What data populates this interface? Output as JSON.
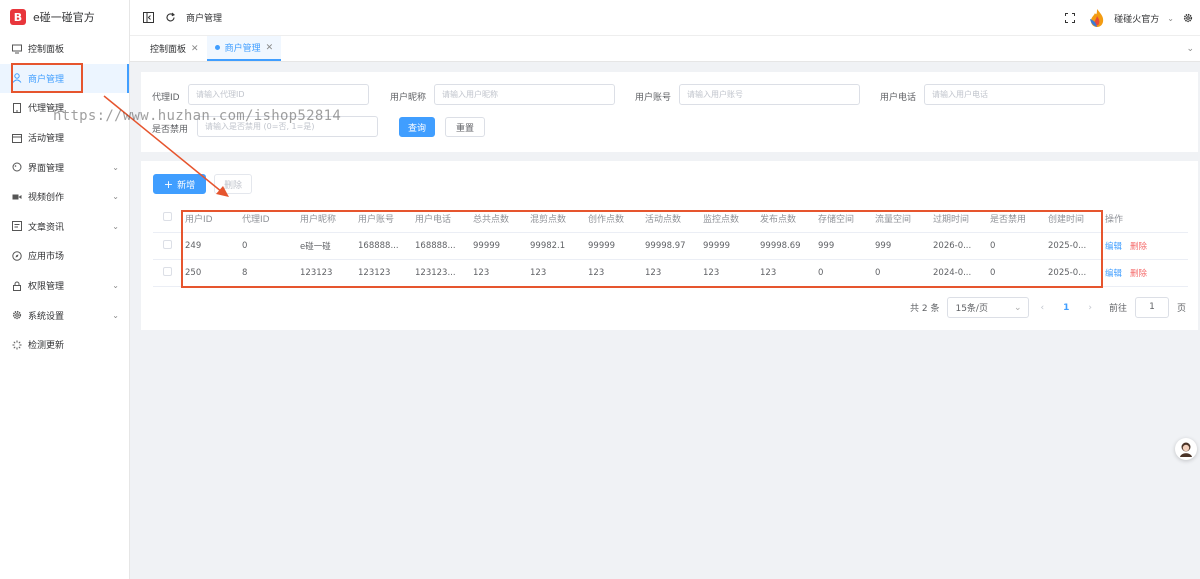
{
  "app": {
    "logo_mark": "B",
    "title": "e碰一碰官方"
  },
  "sidebar": {
    "items": [
      {
        "label": "控制面板",
        "icon": "monitor-icon",
        "expand": false
      },
      {
        "label": "商户管理",
        "icon": "user-icon",
        "expand": false,
        "active": true
      },
      {
        "label": "代理管理",
        "icon": "phone-icon",
        "expand": false
      },
      {
        "label": "活动管理",
        "icon": "calendar-icon",
        "expand": false
      },
      {
        "label": "界面管理",
        "icon": "palette-icon",
        "expand": true
      },
      {
        "label": "视频创作",
        "icon": "video-icon",
        "expand": true
      },
      {
        "label": "文章资讯",
        "icon": "article-icon",
        "expand": true
      },
      {
        "label": "应用市场",
        "icon": "compass-icon",
        "expand": false
      },
      {
        "label": "权限管理",
        "icon": "lock-icon",
        "expand": true
      },
      {
        "label": "系统设置",
        "icon": "gear-icon",
        "expand": true
      },
      {
        "label": "检测更新",
        "icon": "loading-icon",
        "expand": false
      }
    ]
  },
  "topbar": {
    "breadcrumb": "商户管理",
    "username": "碰碰火官方"
  },
  "tabs": [
    {
      "label": "控制面板",
      "active": false
    },
    {
      "label": "商户管理",
      "active": true
    }
  ],
  "search": {
    "agent_id_label": "代理ID",
    "agent_id_placeholder": "请输入代理ID",
    "nickname_label": "用户昵称",
    "nickname_placeholder": "请输入用户昵称",
    "account_label": "用户账号",
    "account_placeholder": "请输入用户账号",
    "phone_label": "用户电话",
    "phone_placeholder": "请输入用户电话",
    "disabled_label": "是否禁用",
    "disabled_placeholder": "请输入是否禁用 (0=否, 1=是)",
    "query_button": "查询",
    "reset_button": "重置"
  },
  "toolbar": {
    "add_button": "新增",
    "delete_button": "删除"
  },
  "table": {
    "columns": [
      "用户ID",
      "代理ID",
      "用户昵称",
      "用户账号",
      "用户电话",
      "总共点数",
      "混剪点数",
      "创作点数",
      "活动点数",
      "监控点数",
      "发布点数",
      "存储空间",
      "流量空间",
      "过期时间",
      "是否禁用",
      "创建时间",
      "操作"
    ],
    "rows": [
      [
        "249",
        "0",
        "e碰一碰",
        "168888...",
        "168888...",
        "99999",
        "99982.1",
        "99999",
        "99998.97",
        "99999",
        "99998.69",
        "999",
        "999",
        "2026-0...",
        "0",
        "2025-0..."
      ],
      [
        "250",
        "8",
        "123123",
        "123123",
        "123123...",
        "123",
        "123",
        "123",
        "123",
        "123",
        "123",
        "0",
        "0",
        "2024-0...",
        "0",
        "2025-0..."
      ]
    ],
    "edit_label": "编辑",
    "delete_label": "删除"
  },
  "pagination": {
    "total": "共 2 条",
    "page_size": "15条/页",
    "current_page": "1",
    "goto_label": "前往",
    "goto_value": "1",
    "page_suffix": "页"
  },
  "watermark": "https://www.huzhan.com/ishop52814",
  "colors": {
    "accent": "#409eff",
    "danger": "#f56c6c",
    "annotation": "#e6552e"
  }
}
